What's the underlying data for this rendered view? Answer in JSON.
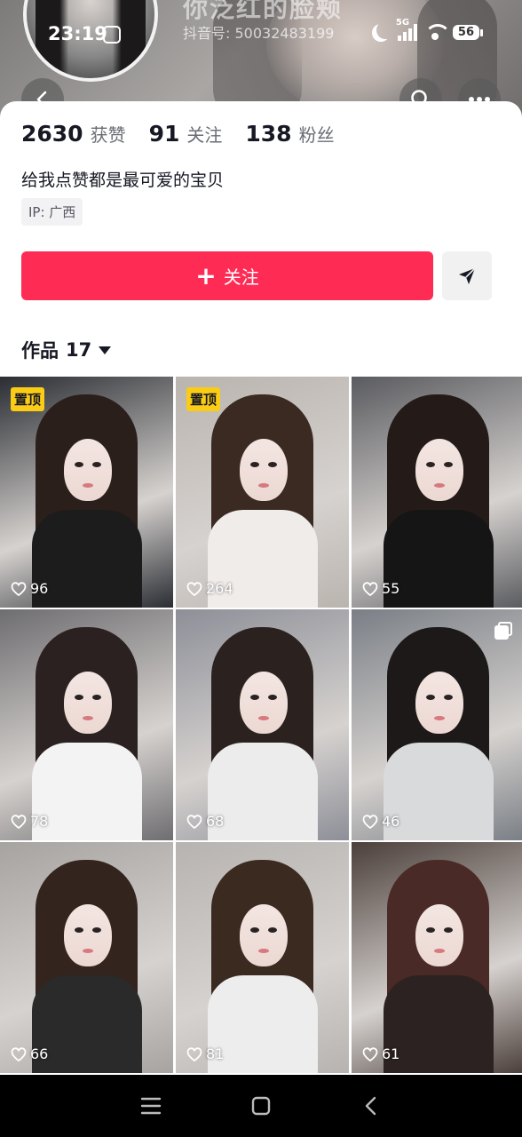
{
  "status_bar": {
    "time": "23:19",
    "network": "5G",
    "battery": "56"
  },
  "profile": {
    "name_partial": "你泛红的脸颊",
    "douyin_id_label": "抖音号: 50032483199",
    "stats": [
      {
        "value": "2630",
        "label": "获赞"
      },
      {
        "value": "91",
        "label": "关注"
      },
      {
        "value": "138",
        "label": "粉丝"
      }
    ],
    "bio": "给我点赞都是最可爱的宝贝",
    "ip": "IP: 广西"
  },
  "actions": {
    "follow_label": "关注",
    "follow_color": "#fe2c55"
  },
  "works": {
    "label": "作品",
    "count": "17"
  },
  "videos": [
    {
      "likes": "96",
      "pinned_label": "置顶",
      "bg": "#2a2d33",
      "hair": "#2b1f1c",
      "body": "#1c1c1c"
    },
    {
      "likes": "264",
      "pinned_label": "置顶",
      "bg": "#b9b4ae",
      "hair": "#3a2a22",
      "body": "#f0ecea"
    },
    {
      "likes": "55",
      "pinned_label": "",
      "bg": "#5a5b60",
      "hair": "#241b18",
      "body": "#151515"
    },
    {
      "likes": "78",
      "pinned_label": "",
      "bg": "#6e6d70",
      "hair": "#2a2120",
      "body": "#f3f3f3"
    },
    {
      "likes": "68",
      "pinned_label": "",
      "bg": "#8d8f98",
      "hair": "#2b2220",
      "body": "#ececec"
    },
    {
      "likes": "46",
      "pinned_label": "",
      "bg": "#7a7f86",
      "hair": "#1e1919",
      "body": "#d9dadc"
    },
    {
      "likes": "66",
      "pinned_label": "",
      "bg": "#a6a3a1",
      "hair": "#33241e",
      "body": "#2a2a2a"
    },
    {
      "likes": "81",
      "pinned_label": "",
      "bg": "#b7b3b0",
      "hair": "#3b2a20",
      "body": "#ededed"
    },
    {
      "likes": "61",
      "pinned_label": "",
      "bg": "#4b3f3a",
      "hair": "#4a2a26",
      "body": "#2d2222"
    }
  ]
}
